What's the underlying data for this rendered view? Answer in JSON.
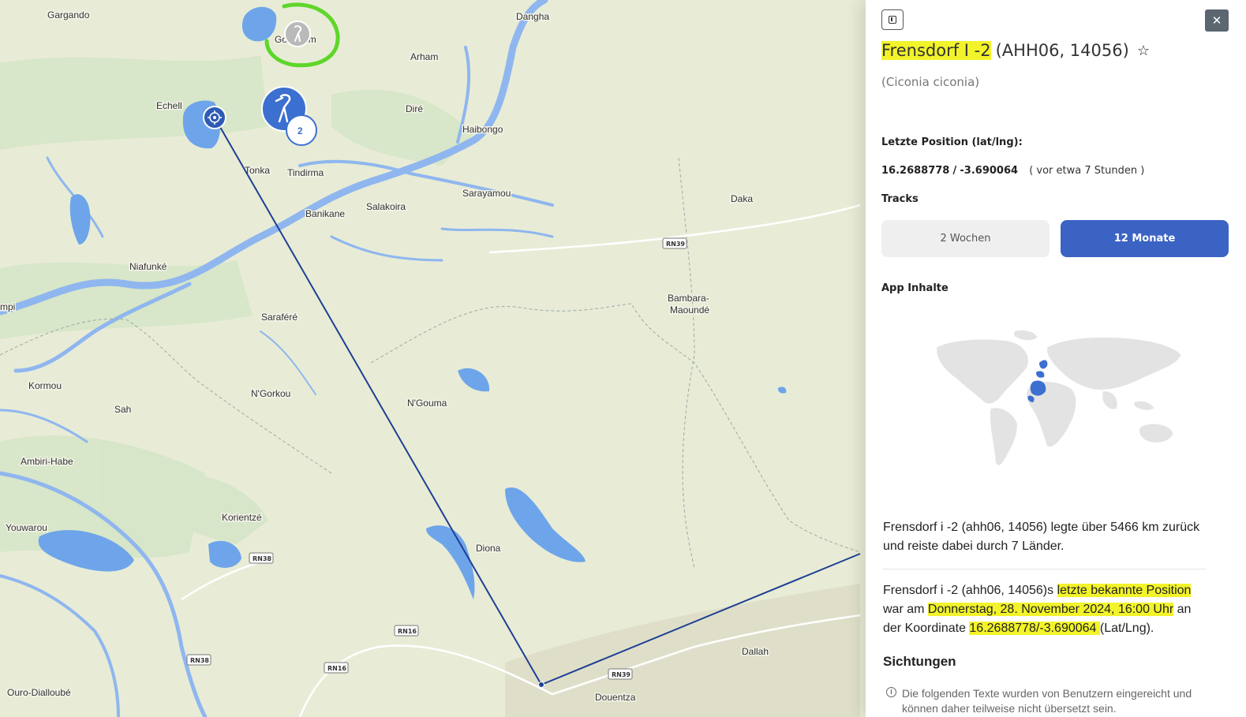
{
  "map": {
    "places": {
      "gargando": "Gargando",
      "goundam": "Goundam",
      "dangha": "Dangha",
      "arham": "Arham",
      "echell": "Echell",
      "dire": "Diré",
      "haibongo": "Haibongo",
      "tonka": "Tonka",
      "tindirma": "Tindirma",
      "sarayamou": "Sarayamou",
      "daka": "Daka",
      "banikane": "Banikane",
      "salakoira": "Salakoira",
      "niafunke": "Niafunké",
      "bambara1": "Bambara-",
      "bambara2": "Maoundé",
      "ampi": "mpi",
      "sarafere": "Saraféré",
      "kormou": "Kormou",
      "ngorkou": "N'Gorkou",
      "sah": "Sah",
      "ngouma": "N'Gouma",
      "ambiri": "Ambiri-Habe",
      "korientze": "Korientzé",
      "youwarou": "Youwarou",
      "diona": "Diona",
      "dallah": "Dallah",
      "douentza": "Douentza",
      "ouro": "Ouro-Dialloubé"
    },
    "roads": {
      "rn39a": "RN39",
      "rn38a": "RN38",
      "rn16a": "RN16",
      "rn38b": "RN38",
      "rn16b": "RN16",
      "rn39b": "RN39"
    },
    "cluster_count": "2",
    "colors": {
      "track": "#1f3f94",
      "marker": "#3b6fd0",
      "annotation": "#5ed62a"
    }
  },
  "panel": {
    "title_main": "Frensdorf I -2",
    "title_ids": "(AHH06, 14056)",
    "latin_name": "(Ciconia ciconia)",
    "last_position_label": "Letzte Position (lat/lng):",
    "coord_lat": "16.2688778",
    "coord_sep": "/",
    "coord_lng": "-3.690064",
    "coord_ago": "( vor etwa 7 Stunden )",
    "tracks_label": "Tracks",
    "tab_2w": "2 Wochen",
    "tab_12m": "12 Monate",
    "app_content_label": "App Inhalte",
    "summary": "Frensdorf i -2 (ahh06, 14056) legte über 5466 km zurück und reiste dabei durch 7 Länder.",
    "pos_p1": "Frensdorf i -2 (ahh06, 14056)s ",
    "pos_h1": "letzte bekannte Position ",
    "pos_p2": "war am ",
    "pos_h2": "Donnerstag, 28. November 2024, 16:00 Uhr",
    "pos_p3": " an der Koordinate ",
    "pos_h3": "16.2688778/-3.690064 ",
    "pos_p4": "(Lat/Lng).",
    "sightings_title": "Sichtungen",
    "sightings_info": "Die folgenden Texte wurden von Benutzern eingereicht und können daher teilweise nicht übersetzt sein.",
    "highlight_color": "#f2f32a",
    "accent_color": "#3b63c4"
  }
}
